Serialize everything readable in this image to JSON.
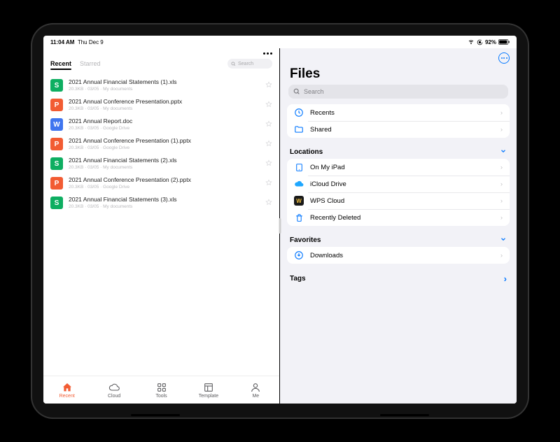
{
  "statusbar": {
    "time": "11:04 AM",
    "date": "Thu Dec 9",
    "battery_text": "92%"
  },
  "wps": {
    "tabs": {
      "recent": "Recent",
      "starred": "Starred"
    },
    "search_placeholder": "Search",
    "files": [
      {
        "icon": "S",
        "cls": "fi-s",
        "name": "2021 Annual Financial Statements (1).xls",
        "meta": "20.3KB · 03/05 · My documents"
      },
      {
        "icon": "P",
        "cls": "fi-p",
        "name": "2021 Annual Conference Presentation.pptx",
        "meta": "20.3KB · 03/05 · My documents"
      },
      {
        "icon": "W",
        "cls": "fi-w",
        "name": "2021 Annual Report.doc",
        "meta": "20.3KB · 03/05 · Google Drive"
      },
      {
        "icon": "P",
        "cls": "fi-p",
        "name": "2021 Annual Conference Presentation (1).pptx",
        "meta": "20.3KB · 03/05 · Google Drive"
      },
      {
        "icon": "S",
        "cls": "fi-s",
        "name": "2021 Annual Financial Statements (2).xls",
        "meta": "20.3KB · 03/05 · My documents"
      },
      {
        "icon": "P",
        "cls": "fi-p",
        "name": "2021 Annual Conference Presentation (2).pptx",
        "meta": "20.3KB · 03/05 · Google Drive"
      },
      {
        "icon": "S",
        "cls": "fi-s",
        "name": "2021 Annual Financial Statements (3).xls",
        "meta": "20.3KB · 03/05 · My documents"
      }
    ],
    "tabbar": {
      "recent": "Recent",
      "cloud": "Cloud",
      "tools": "Tools",
      "template": "Template",
      "me": "Me"
    }
  },
  "files": {
    "title": "Files",
    "search_placeholder": "Search",
    "top": {
      "recents": "Recents",
      "shared": "Shared"
    },
    "locations_hdr": "Locations",
    "locations": {
      "onipad": "On My iPad",
      "icloud": "iCloud Drive",
      "wps": "WPS Cloud",
      "deleted": "Recently Deleted"
    },
    "favorites_hdr": "Favorites",
    "favorites": {
      "downloads": "Downloads"
    },
    "tags_hdr": "Tags"
  }
}
